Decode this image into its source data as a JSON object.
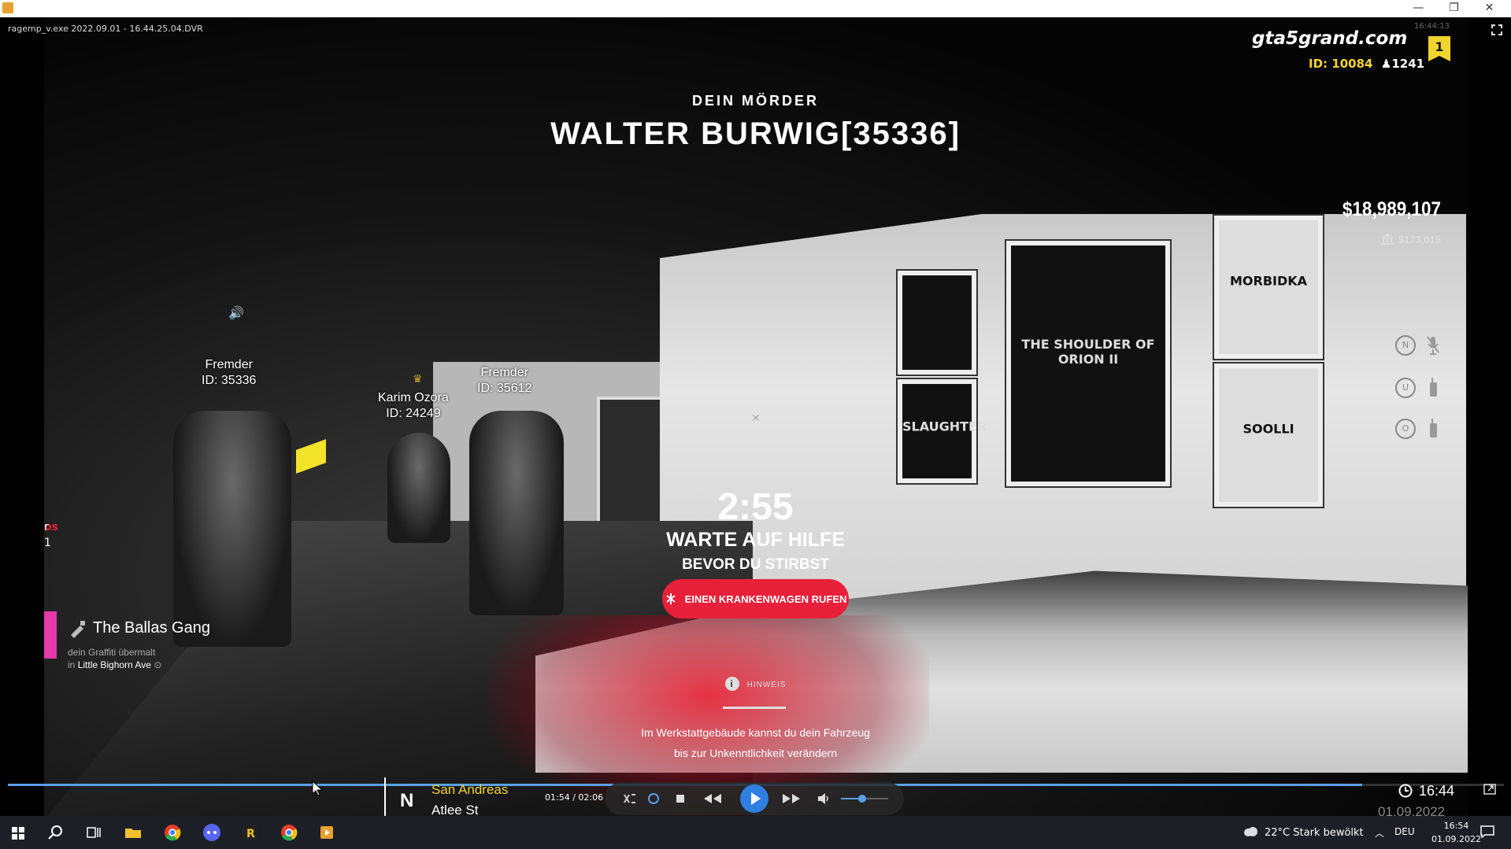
{
  "window": {
    "minimize_glyph": "—",
    "restore_glyph": "❐",
    "close_glyph": "✕"
  },
  "player": {
    "file_title": "ragemp_v.exe 2022.09.01 - 16.44.25.04.DVR",
    "time_display": "01:54 / 02:06",
    "progress": 0.905,
    "volume": 0.45
  },
  "hud": {
    "logo": "gta5grand.com",
    "id_label": "ID: 10084",
    "players_online": "1241",
    "level": "1",
    "clock_faint": "16:44:13",
    "money": "$18,989,107",
    "bank": "$173,015",
    "voice_keys": [
      "N",
      "U",
      "O"
    ]
  },
  "death": {
    "killer_label": "DEIN MÖRDER",
    "killer_name": "WALTER BURWIG[35336]",
    "timer": "2:55",
    "wait_line1": "WARTE AUF HILFE",
    "wait_line2": "BEVOR DU STIRBST",
    "ambulance_button": "EINEN KRANKENWAGEN RUFEN",
    "hint_label": "HINWEIS",
    "hint_line1": "Im Werkstattgebäude kannst du dein Fahrzeug",
    "hint_line2": "bis zur Unkenntlichkeit verändern"
  },
  "players": [
    {
      "name": "Fremder",
      "id": "ID: 35336"
    },
    {
      "name": "Karim Ozora",
      "id": "ID: 24249"
    },
    {
      "name": "Fremder",
      "id": "ID: 35612"
    }
  ],
  "left_hud": {
    "red_text": "os",
    "line1": "r",
    "line2": "1"
  },
  "gang_notice": {
    "gang_name": "The Ballas Gang",
    "line1": "dein Graffiti übermalt",
    "line2_prefix": "in",
    "location": "Little Bighorn Ave"
  },
  "posters": [
    {
      "title": "SLAUGHTER"
    },
    {
      "title": "THE SHOULDER OF ORION II"
    },
    {
      "title": "MORBIDKA"
    },
    {
      "title": "SOOLLI"
    }
  ],
  "location": {
    "compass": "N",
    "zone": "San Andreas",
    "street": "Atlee St"
  },
  "game_clock": {
    "time": "16:44",
    "date": "01.09.2022"
  },
  "taskbar": {
    "weather": "22°C  Stark bewölkt",
    "language": "DEU",
    "time": "16:54",
    "date": "01.09.2022"
  },
  "colors": {
    "accent_red": "#e8203a",
    "hud_yellow": "#f2d430",
    "seek_blue": "#5aa0e8",
    "gang_pink": "#e63aa8"
  }
}
